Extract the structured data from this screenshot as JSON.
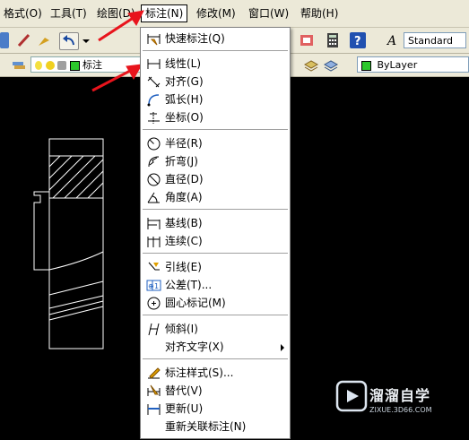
{
  "menubar": {
    "items": [
      {
        "label": "格式(O)"
      },
      {
        "label": "工具(T)"
      },
      {
        "label": "绘图(D)"
      },
      {
        "label": "标注(N)"
      },
      {
        "label": "修改(M)"
      },
      {
        "label": "窗口(W)"
      },
      {
        "label": "帮助(H)"
      }
    ]
  },
  "toolbar": {
    "text_style": "Standard",
    "layer_label": "标注",
    "color_value": "ByLayer"
  },
  "dimension_menu": {
    "items": [
      {
        "label": "快速标注(Q)",
        "icon": "quick-dim-icon"
      },
      {
        "label": "线性(L)",
        "icon": "linear-dim-icon"
      },
      {
        "label": "对齐(G)",
        "icon": "aligned-dim-icon"
      },
      {
        "label": "弧长(H)",
        "icon": "arc-length-icon"
      },
      {
        "label": "坐标(O)",
        "icon": "ordinate-icon"
      },
      {
        "label": "半径(R)",
        "icon": "radius-icon"
      },
      {
        "label": "折弯(J)",
        "icon": "jogged-icon"
      },
      {
        "label": "直径(D)",
        "icon": "diameter-icon"
      },
      {
        "label": "角度(A)",
        "icon": "angular-icon"
      },
      {
        "label": "基线(B)",
        "icon": "baseline-icon"
      },
      {
        "label": "连续(C)",
        "icon": "continue-icon"
      },
      {
        "label": "引线(E)",
        "icon": "leader-icon"
      },
      {
        "label": "公差(T)...",
        "icon": "tolerance-icon"
      },
      {
        "label": "圆心标记(M)",
        "icon": "center-mark-icon"
      },
      {
        "label": "倾斜(I)",
        "icon": "oblique-icon"
      },
      {
        "label": "对齐文字(X)",
        "icon": ""
      },
      {
        "label": "标注样式(S)...",
        "icon": "dim-style-icon"
      },
      {
        "label": "替代(V)",
        "icon": "override-icon"
      },
      {
        "label": "更新(U)",
        "icon": "update-icon"
      },
      {
        "label": "重新关联标注(N)",
        "icon": ""
      }
    ]
  },
  "watermark": {
    "brand": "溜溜自学",
    "url": "ZIXUE.3D66.COM"
  },
  "colors": {
    "menu_bg": "#ece9d8",
    "canvas_bg": "#000000",
    "arrow": "#e8141c"
  }
}
